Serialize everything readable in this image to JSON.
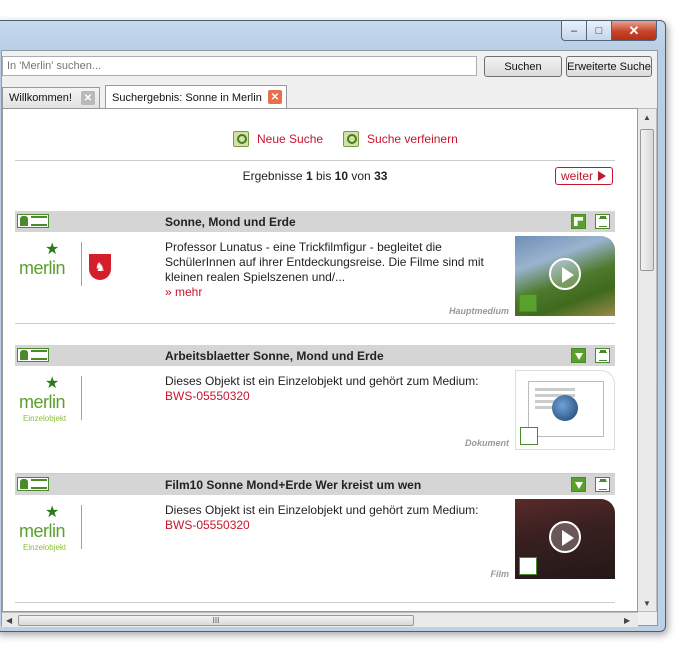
{
  "window": {
    "min_symbol": "–",
    "max_symbol": "□",
    "close_symbol": "✕"
  },
  "search": {
    "placeholder": "In 'Merlin' suchen...",
    "search_label": "Suchen",
    "advanced_label": "Erweiterte Suche"
  },
  "tabs": [
    {
      "label": "Willkommen!",
      "close": "✕"
    },
    {
      "label": "Suchergebnis: Sonne in Merlin",
      "close": "✕"
    }
  ],
  "actions": {
    "new_search": "Neue Suche",
    "refine": "Suche verfeinern"
  },
  "pager": {
    "prefix": "Ergebnisse",
    "from": "1",
    "mid": "bis",
    "to": "10",
    "of_word": "von",
    "total": "33",
    "next_label": "weiter"
  },
  "results": [
    {
      "title": "Sonne, Mond und Erde",
      "desc": "Professor Lunatus - eine Trickfilmfigur - begleitet die SchülerInnen auf ihrer Entdeckungsreise. Die Filme sind mit kleinen realen Spielszenen und/...",
      "link": "» mehr",
      "medium": "Hauptmedium",
      "logo_word": "merlin"
    },
    {
      "title": "Arbeitsblaetter Sonne, Mond und Erde",
      "desc": "Dieses Objekt ist ein Einzelobjekt und gehört zum Medium:",
      "link": "BWS-05550320",
      "medium": "Dokument",
      "logo_word": "merlin",
      "logo_sub": "Einzelobjekt"
    },
    {
      "title": "Film10 Sonne Mond+Erde Wer kreist um wen",
      "desc": "Dieses Objekt ist ein Einzelobjekt und gehört zum Medium:",
      "link": "BWS-05550320",
      "medium": "Film",
      "logo_word": "merlin",
      "logo_sub": "Einzelobjekt"
    }
  ],
  "scroll": {
    "h_grip": "III"
  },
  "colors": {
    "accent": "#c7152e",
    "green": "#5aa02c",
    "header_gray": "#d5d5d5"
  }
}
